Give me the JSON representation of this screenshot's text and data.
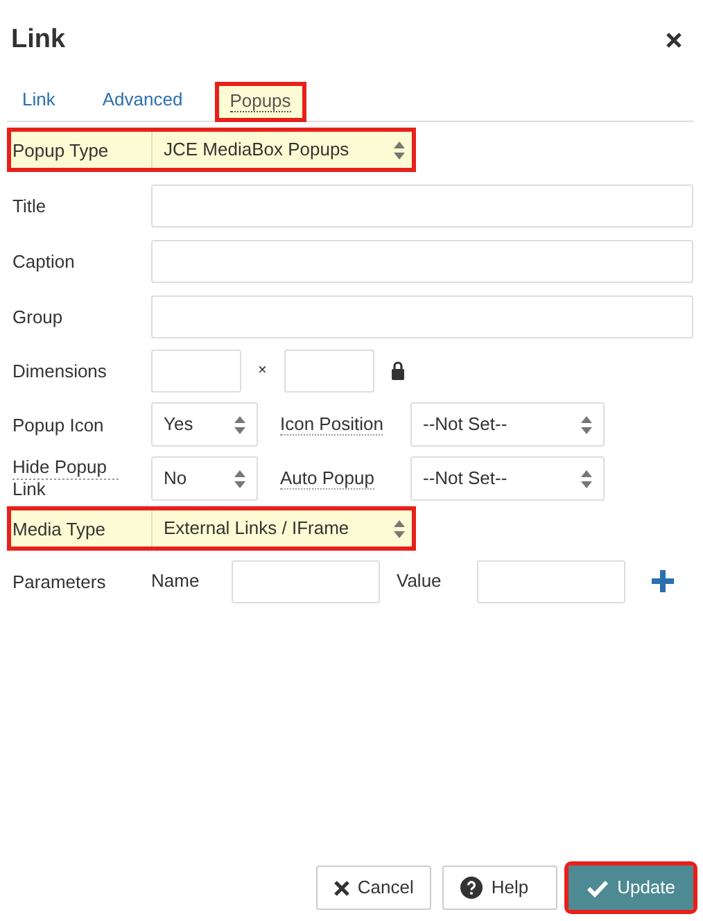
{
  "dialog": {
    "title": "Link"
  },
  "tabs": [
    {
      "label": "Link",
      "selected": false,
      "highlighted": false
    },
    {
      "label": "Advanced",
      "selected": false,
      "highlighted": false
    },
    {
      "label": "Popups",
      "selected": true,
      "highlighted": true
    }
  ],
  "fields": [
    {
      "kind": "select",
      "label": "Popup Type",
      "value": "JCE MediaBox Popups",
      "highlighted": true
    },
    {
      "kind": "text",
      "label": "Title"
    },
    {
      "kind": "text",
      "label": "Caption"
    },
    {
      "kind": "text",
      "label": "Group"
    },
    {
      "kind": "dimensions",
      "label": "Dimensions",
      "separator": "×"
    },
    {
      "kind": "select-pair",
      "label": "Popup Icon",
      "value": "Yes",
      "label_2": "Icon Position",
      "value_2": "--Not Set--"
    },
    {
      "kind": "select-pair",
      "label": "Hide Popup Link",
      "value": "No",
      "label_2": "Auto Popup",
      "value_2": "--Not Set--"
    },
    {
      "kind": "select",
      "label": "Media Type",
      "value": "External Links / IFrame",
      "highlighted": true
    },
    {
      "kind": "parameters",
      "label": "Parameters",
      "name_label": "Name",
      "value_label": "Value"
    }
  ],
  "buttons": [
    {
      "kind": "cancel",
      "label": "Cancel",
      "highlighted": false
    },
    {
      "kind": "help",
      "label": "Help",
      "highlighted": false
    },
    {
      "kind": "update",
      "label": "Update",
      "highlighted": true
    }
  ]
}
